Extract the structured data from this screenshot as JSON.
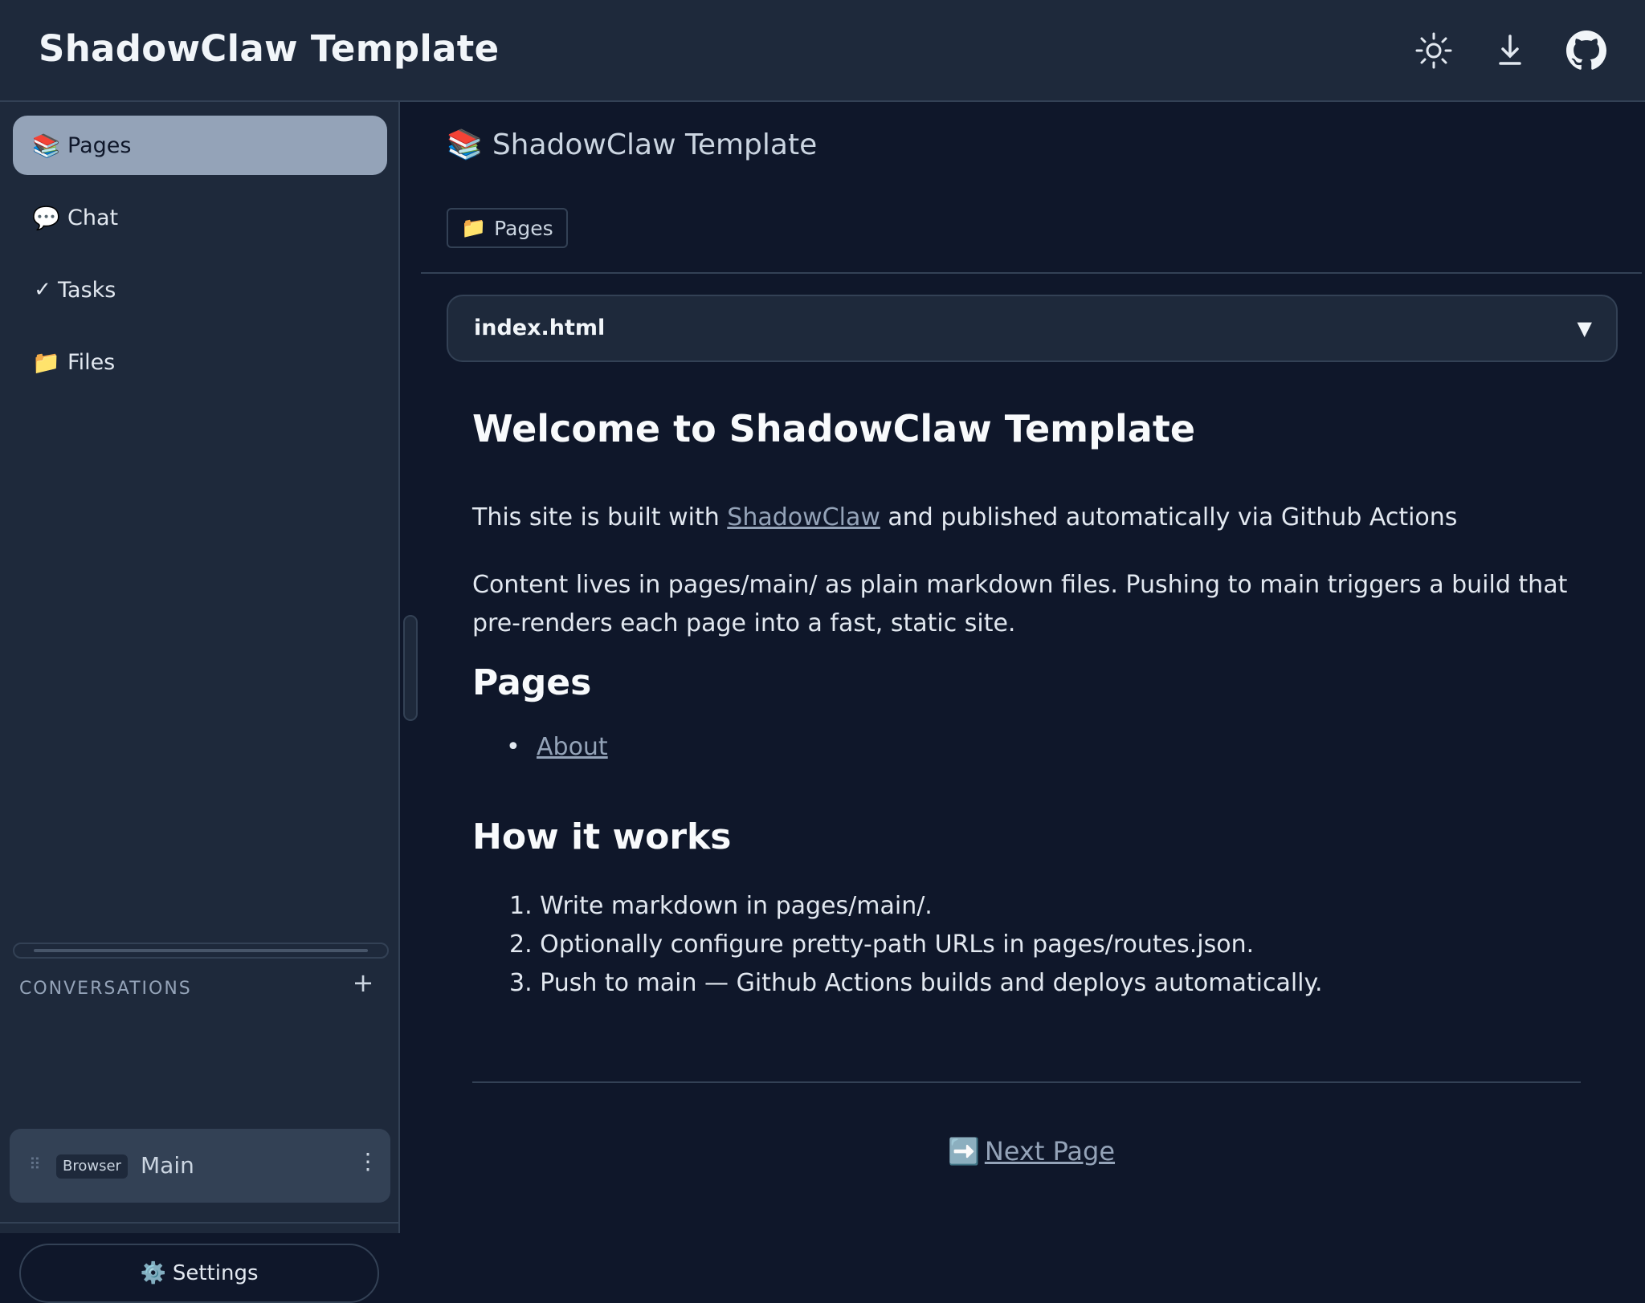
{
  "header": {
    "title": "ShadowClaw Template",
    "icons": [
      "sun-icon",
      "download-icon",
      "github-icon"
    ]
  },
  "sidebar": {
    "nav": [
      {
        "icon": "📚",
        "label": "Pages",
        "active": true
      },
      {
        "icon": "💬",
        "label": "Chat",
        "active": false
      },
      {
        "icon": "✓",
        "label": "Tasks",
        "active": false
      },
      {
        "icon": "📁",
        "label": "Files",
        "active": false
      }
    ],
    "conversations_label": "CONVERSATIONS",
    "add_symbol": "+",
    "conversation": {
      "grip": "⠿",
      "badge": "Browser",
      "name": "Main",
      "more": "⋮"
    },
    "settings": {
      "icon": "⚙️",
      "label": "Settings"
    }
  },
  "main": {
    "title_icon": "📚",
    "title": "ShadowClaw Template",
    "chip": {
      "icon": "📁",
      "label": "Pages"
    },
    "file_select": {
      "value": "index.html",
      "caret": "▼"
    },
    "article": {
      "h1": "Welcome to ShadowClaw Template",
      "p1_pre": "This site is built with ",
      "p1_link": "ShadowClaw",
      "p1_post": " and published automatically via Github Actions",
      "p2": "Content lives in pages/main/ as plain markdown files. Pushing to main triggers a build that pre-renders each page into a fast, static site.",
      "h2_pages": "Pages",
      "bullet": "•",
      "pages_link": "About",
      "h2_how": "How it works",
      "steps": [
        "1. Write markdown in pages/main/.",
        "2. Optionally configure pretty-path URLs in pages/routes.json.",
        "3. Push to main — Github Actions builds and deploys automatically."
      ],
      "next_icon": "➡️",
      "next_label": "Next Page"
    }
  },
  "colors": {
    "header_bg": "#1e293b",
    "main_bg": "#0f172a",
    "active_nav_bg": "#94a3b8",
    "link": "#94a3b8",
    "border": "#334155"
  }
}
